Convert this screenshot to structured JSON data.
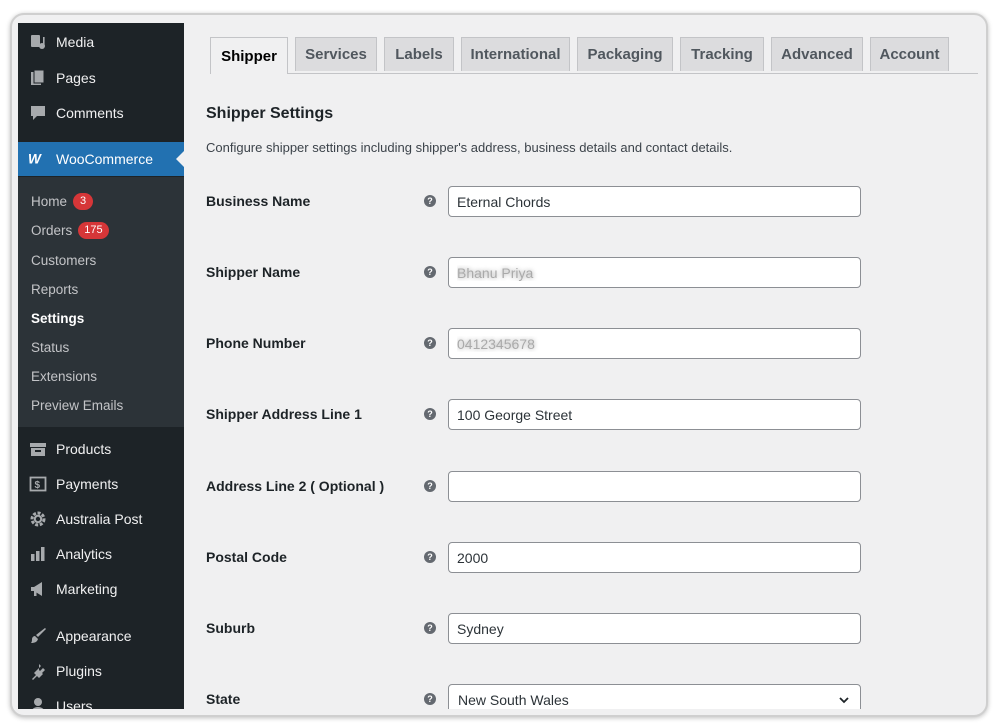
{
  "sidebar": {
    "top_items": [
      {
        "label": "Media",
        "icon": "media-icon"
      },
      {
        "label": "Pages",
        "icon": "pages-icon"
      },
      {
        "label": "Comments",
        "icon": "comments-icon"
      }
    ],
    "woocommerce": {
      "label": "WooCommerce",
      "icon": "woocommerce-icon"
    },
    "submenu": [
      {
        "label": "Home",
        "badge": "3"
      },
      {
        "label": "Orders",
        "badge": "175"
      },
      {
        "label": "Customers"
      },
      {
        "label": "Reports"
      },
      {
        "label": "Settings",
        "current": true
      },
      {
        "label": "Status"
      },
      {
        "label": "Extensions"
      },
      {
        "label": "Preview Emails"
      }
    ],
    "bottom_items": [
      {
        "label": "Products",
        "icon": "products-icon"
      },
      {
        "label": "Payments",
        "icon": "payments-icon"
      },
      {
        "label": "Australia Post",
        "icon": "gear-icon"
      },
      {
        "label": "Analytics",
        "icon": "analytics-icon"
      },
      {
        "label": "Marketing",
        "icon": "megaphone-icon"
      },
      {
        "label": "Appearance",
        "icon": "paintbrush-icon"
      },
      {
        "label": "Plugins",
        "icon": "plugin-icon"
      },
      {
        "label": "Users",
        "icon": "user-icon"
      }
    ]
  },
  "tabs": [
    "Shipper",
    "Services",
    "Labels",
    "International",
    "Packaging",
    "Tracking",
    "Advanced",
    "Account"
  ],
  "active_tab": "Shipper",
  "section": {
    "title": "Shipper Settings",
    "description": "Configure shipper settings including shipper's address, business details and contact details."
  },
  "fields": [
    {
      "label": "Business Name",
      "value": "Eternal Chords"
    },
    {
      "label": "Shipper Name",
      "value": "Bhanu Priya",
      "blurred": true
    },
    {
      "label": "Phone Number",
      "value": "0412345678",
      "blurred": true
    },
    {
      "label": "Shipper Address Line 1",
      "value": "100 George Street"
    },
    {
      "label": "Address Line 2 ( Optional )",
      "value": ""
    },
    {
      "label": "Postal Code",
      "value": "2000"
    },
    {
      "label": "Suburb",
      "value": "Sydney"
    },
    {
      "label": "State",
      "value": "New South Wales",
      "type": "select"
    }
  ],
  "colors": {
    "sidebar_bg": "#1d2327",
    "submenu_bg": "#2c3338",
    "accent": "#2271b1",
    "badge": "#d63638"
  }
}
